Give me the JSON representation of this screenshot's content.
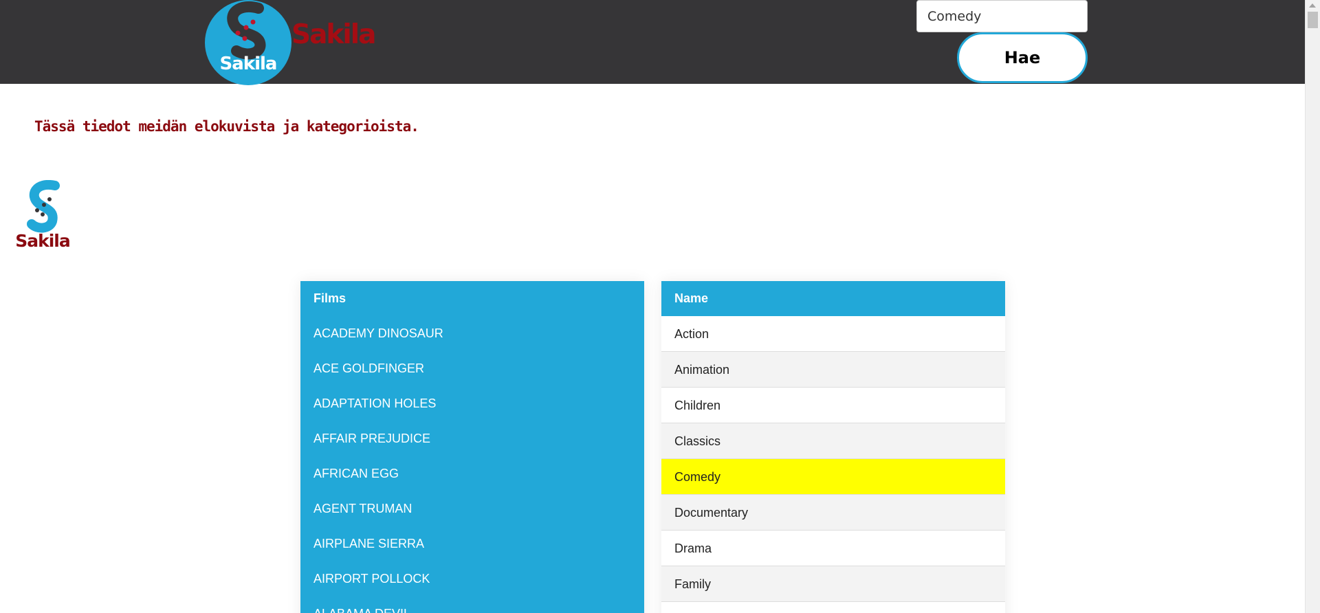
{
  "header": {
    "logo_text": "Sakila",
    "brand_name": "Sakila"
  },
  "search": {
    "value": "Comedy",
    "button_label": "Hae"
  },
  "intro_text": "Tässä tiedot meidän elokuvista ja kategorioista.",
  "small_logo_text": "Sakila",
  "films": {
    "header": "Films",
    "rows": [
      "ACADEMY DINOSAUR",
      "ACE GOLDFINGER",
      "ADAPTATION HOLES",
      "AFFAIR PREJUDICE",
      "AFRICAN EGG",
      "AGENT TRUMAN",
      "AIRPLANE SIERRA",
      "AIRPORT POLLOCK",
      "ALABAMA DEVIL"
    ]
  },
  "categories": {
    "header": "Name",
    "selected": "Comedy",
    "rows": [
      "Action",
      "Animation",
      "Children",
      "Classics",
      "Comedy",
      "Documentary",
      "Drama",
      "Family"
    ]
  },
  "colors": {
    "header_bg": "#363537",
    "accent_blue": "#22a8d8",
    "brand_red": "#a50d13",
    "highlight": "#ffff00"
  }
}
